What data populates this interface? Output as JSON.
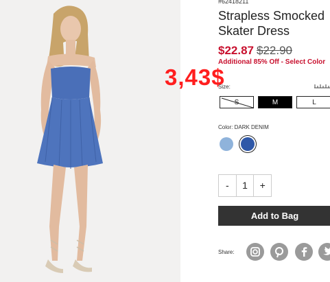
{
  "product": {
    "sku": "#62418211",
    "title": "Strapless Smocked Skater Dress",
    "price_current": "$22.87",
    "price_original": "$22.90",
    "promo": "Additional 85% Off - Select Color",
    "overlay_price": "3,43$"
  },
  "size": {
    "label": "Size:",
    "options": [
      "S",
      "M",
      "L"
    ],
    "selected": "M",
    "unavailable": [
      "S"
    ],
    "guide_icon": "ruler-icon"
  },
  "color": {
    "label_prefix": "Color:",
    "selected_name": "DARK DENIM",
    "swatches": [
      {
        "name": "light-denim",
        "hex": "#8fb3db"
      },
      {
        "name": "dark-denim",
        "hex": "#2f58a8"
      }
    ]
  },
  "quantity": {
    "minus": "-",
    "value": "1",
    "plus": "+"
  },
  "add_to_bag": "Add to Bag",
  "share": {
    "label": "Share:",
    "icons": [
      "instagram-icon",
      "pinterest-icon",
      "facebook-icon",
      "twitter-icon"
    ]
  },
  "colors": {
    "price_red": "#c8102e",
    "overlay_red": "#ff1e1e",
    "button_dark": "#333333",
    "dress_blue": "#4a6fb8"
  }
}
